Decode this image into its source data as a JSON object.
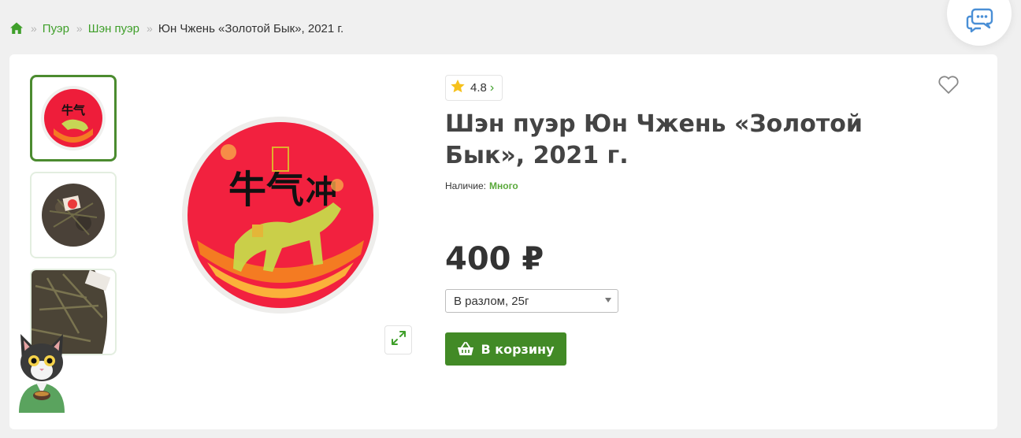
{
  "breadcrumb": {
    "home_icon": "home-icon",
    "separator": "»",
    "items": [
      {
        "label": "Пуэр"
      },
      {
        "label": "Шэн пуэр"
      }
    ],
    "current": "Юн Чжень «Золотой Бык», 2021 г."
  },
  "chat": {
    "icon": "chat-bubble-icon"
  },
  "gallery": {
    "thumbnails": [
      "thumbnail-1",
      "thumbnail-2",
      "thumbnail-3"
    ],
    "selected_index": 0,
    "zoom_icon": "expand-icon"
  },
  "product": {
    "rating": "4.8",
    "rating_chevron": "›",
    "title": "Шэн пуэр Юн Чжень «Золотой Бык», 2021 г.",
    "stock_label": "Наличие:",
    "stock_value": "Много",
    "price": "400 ₽",
    "variant_selected": "В разлом, 25г",
    "add_to_cart": "В корзину"
  },
  "colors": {
    "accent_green": "#428a26",
    "link_green": "#3f9f2a",
    "stock_green": "#5aa93b",
    "star_yellow": "#f6c11c"
  }
}
